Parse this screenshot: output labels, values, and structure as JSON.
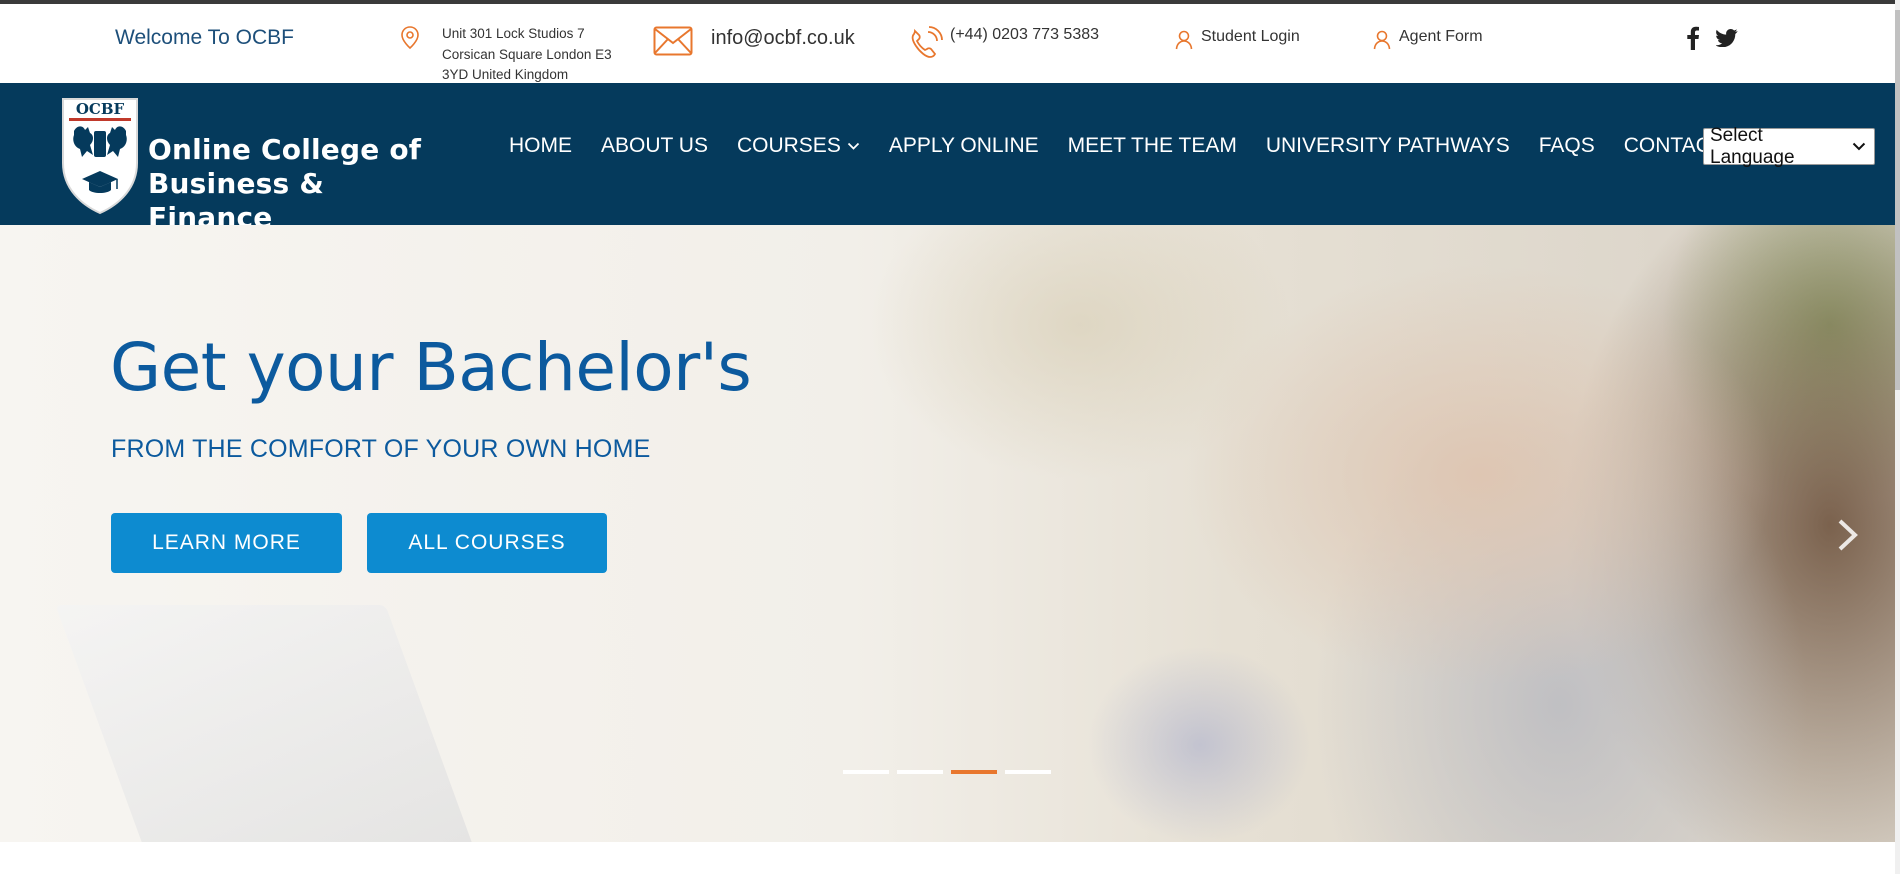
{
  "topbar": {
    "welcome": "Welcome To OCBF",
    "address_lines": [
      "Unit 301 Lock Studios 7",
      "Corsican Square London E3",
      "3YD United Kingdom"
    ],
    "email": "info@ocbf.co.uk",
    "phone": "(+44) 0203 773 5383",
    "student_login": "Student Login",
    "agent_form": "Agent Form",
    "social_icons": [
      "facebook-icon",
      "twitter-icon",
      "instagram-icon"
    ]
  },
  "logo": {
    "abbr": "OCBF",
    "line1": "Online College of",
    "line2": "Business & Finance"
  },
  "nav": {
    "items": [
      "HOME",
      "ABOUT US",
      "COURSES",
      "APPLY ONLINE",
      "MEET THE TEAM",
      "UNIVERSITY PATHWAYS",
      "FAQS",
      "CONTACT US"
    ],
    "language": "Select Language"
  },
  "hero": {
    "title": "Get your Bachelor's",
    "subtitle": "FROM THE COMFORT OF YOUR OWN HOME",
    "btn_learn": "LEARN MORE",
    "btn_courses": "ALL COURSES",
    "slides_total": 4,
    "active_slide": 3
  },
  "colors": {
    "navbar_bg": "#053a5c",
    "accent_orange": "#e8772e",
    "button_blue": "#0d8bd0",
    "heading_blue": "#0c5a9e"
  }
}
